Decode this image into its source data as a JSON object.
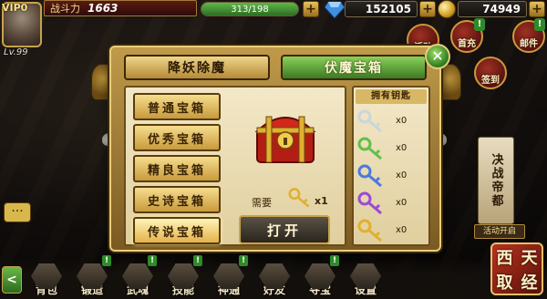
{
  "hud": {
    "vip_label": "VIP0",
    "level_label": "Lv.99",
    "power_label": "战斗力",
    "power_value": "1663",
    "energy_value": "313/198",
    "energy_fill_fraction": 1.0,
    "gems_value": "152105",
    "coins_value": "74949",
    "plus_label": "+"
  },
  "right_menu": [
    {
      "label": "活动",
      "icon": "activity-icon"
    },
    {
      "label": "首充",
      "icon": "first-recharge-icon"
    },
    {
      "label": "签到",
      "icon": "sign-in-icon"
    },
    {
      "label": "邮件",
      "icon": "mail-icon"
    }
  ],
  "modal": {
    "tabs": [
      {
        "label": "降妖除魔",
        "active": false
      },
      {
        "label": "伏魔宝箱",
        "active": true
      }
    ],
    "close_label": "✕",
    "chest_buttons": [
      {
        "label": "普通宝箱"
      },
      {
        "label": "优秀宝箱"
      },
      {
        "label": "精良宝箱"
      },
      {
        "label": "史诗宝箱"
      },
      {
        "label": "传说宝箱"
      }
    ],
    "need_label": "需要",
    "need_qty": "x1",
    "open_label": "打开",
    "keys_title": "拥有钥匙",
    "keys": [
      {
        "color": "#c9d6dc",
        "qty": "x0"
      },
      {
        "color": "#5fc04a",
        "qty": "x0"
      },
      {
        "color": "#4a7ae0",
        "qty": "x0"
      },
      {
        "color": "#9a4ad8",
        "qty": "x0"
      },
      {
        "color": "#e0b030",
        "qty": "x0"
      }
    ],
    "need_key_color": "#e0b030"
  },
  "bottom_nav": [
    {
      "label": "背包",
      "badge": false
    },
    {
      "label": "锻造",
      "badge": true
    },
    {
      "label": "武魂",
      "badge": true
    },
    {
      "label": "技能",
      "badge": true
    },
    {
      "label": "神通",
      "badge": true
    },
    {
      "label": "好友",
      "badge": false
    },
    {
      "label": "寻宝",
      "badge": true
    },
    {
      "label": "设置",
      "badge": false
    }
  ],
  "nav_arrow_label": "<",
  "badge_label": "!",
  "chat_label": "···",
  "scroll_text": "决战帝都",
  "event_label": "活动开启",
  "seal_chars": [
    "西",
    "天",
    "取",
    "经"
  ],
  "colors": {
    "accent_gold": "#e9cd7c",
    "active_tab_green": "#3c7a22"
  }
}
